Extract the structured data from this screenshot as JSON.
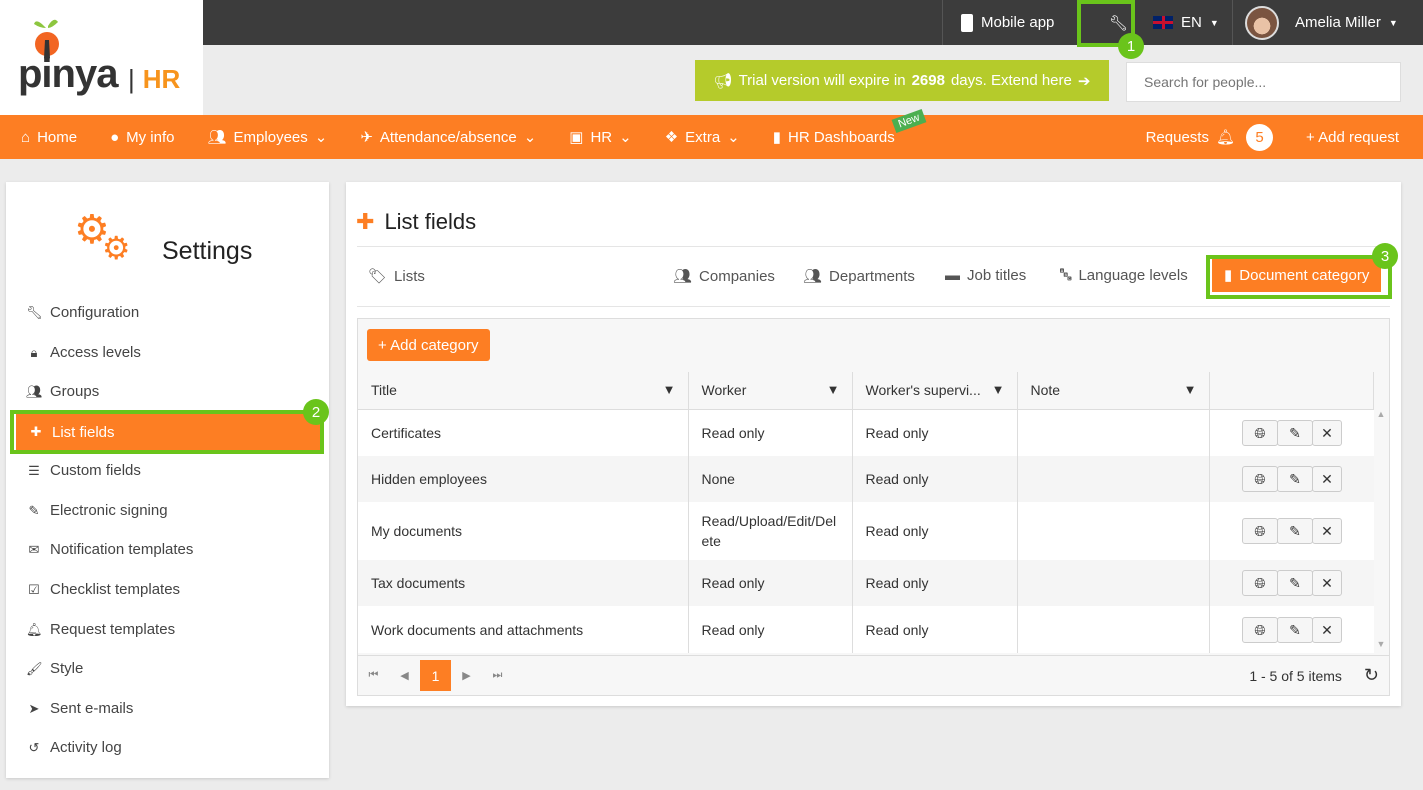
{
  "logo": {
    "text": "pinya",
    "suffix": "HR"
  },
  "topbar": {
    "mobile_app": "Mobile app",
    "lang": "EN",
    "user": "Amelia Miller"
  },
  "trial": {
    "pre": "Trial version will expire in",
    "days": "2698",
    "post": "days.  Extend here"
  },
  "search": {
    "placeholder": "Search for people..."
  },
  "nav": {
    "items": [
      "Home",
      "My info",
      "Employees",
      "Attendance/absence",
      "HR",
      "Extra",
      "HR Dashboards"
    ],
    "new_badge": "New",
    "requests": "Requests",
    "requests_count": "5",
    "add_request": "+ Add request"
  },
  "sidebar": {
    "title": "Settings",
    "items": [
      "Configuration",
      "Access levels",
      "Groups",
      "List fields",
      "Custom fields",
      "Electronic signing",
      "Notification templates",
      "Checklist templates",
      "Request templates",
      "Style",
      "Sent e-mails",
      "Activity log"
    ]
  },
  "main": {
    "title": "List fields",
    "tabs": [
      "Lists",
      "Companies",
      "Departments",
      "Job titles",
      "Language levels",
      "Document category"
    ],
    "add_button": "+ Add category",
    "columns": [
      "Title",
      "Worker",
      "Worker's supervi...",
      "Note"
    ],
    "rows": [
      [
        "Certificates",
        "Read only",
        "Read only",
        ""
      ],
      [
        "Hidden employees",
        "None",
        "Read only",
        ""
      ],
      [
        "My documents",
        "Read/Upload/Edit/Delete",
        "Read only",
        ""
      ],
      [
        "Tax documents",
        "Read only",
        "Read only",
        ""
      ],
      [
        "Work documents and attachments",
        "Read only",
        "Read only",
        ""
      ]
    ],
    "page": "1",
    "summary": "1 - 5 of 5 items"
  },
  "annotations": [
    "1",
    "2",
    "3"
  ],
  "colors": {
    "orange": "#fd7e23",
    "green": "#6ac41b",
    "lime": "#b5cb2b"
  }
}
